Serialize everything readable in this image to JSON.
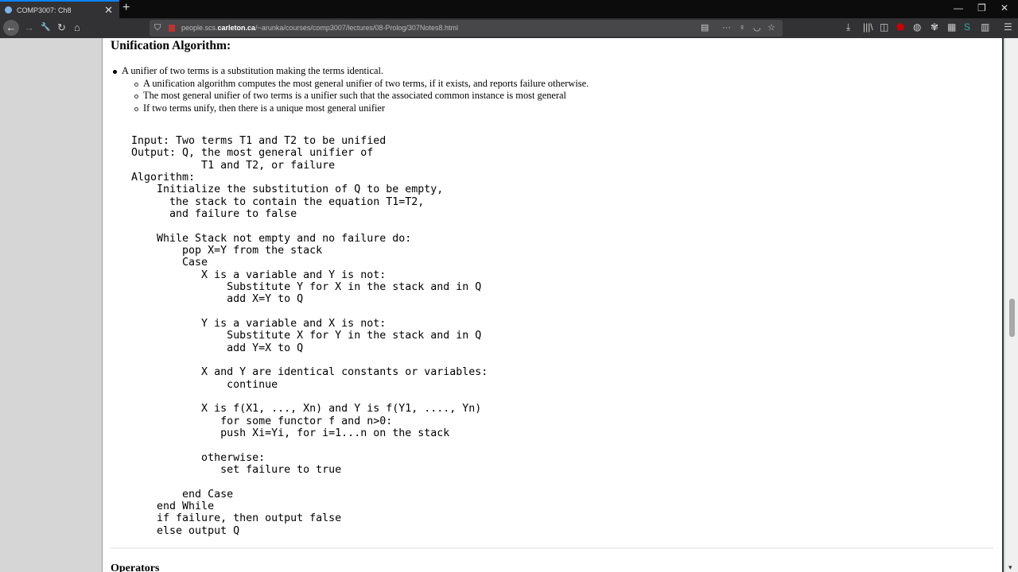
{
  "tab": {
    "title": "COMP3007: Ch8",
    "close": "✕",
    "new_tab": "+"
  },
  "window": {
    "minimize": "—",
    "restore": "❐",
    "close": "✕"
  },
  "nav": {
    "back": "←",
    "forward": "→",
    "tools": "🔧",
    "reload": "↻",
    "home": "⌂"
  },
  "url": {
    "prefix": "people.scs.",
    "domain": "carleton.ca",
    "path": "/~arunka/courses/comp3007/lectures/08-Prolog/307Notes8.html"
  },
  "toolbar_icons": [
    "reader-icon",
    "more-icon",
    "lightbulb-icon",
    "pocket-icon",
    "bookmark-star-icon",
    "download-icon",
    "library-icon",
    "sidebar-icon",
    "ublock-icon",
    "extension-icon",
    "extension2-icon",
    "notes-icon",
    "s-extension-icon",
    "grid-extension-icon",
    "menu-icon"
  ],
  "content": {
    "heading": "Unification Algorithm:",
    "bullet": "A unifier of two terms is a substitution making the terms identical.",
    "sub_bullets": [
      "A unification algorithm computes the most general unifier of two terms, if it exists, and reports failure otherwise.",
      "The most general unifier of two terms is a unifier such that the associated common instance is most general",
      "If two terms unify, then there is a unique most general unifier"
    ],
    "code": [
      "Input: Two terms T1 and T2 to be unified",
      "Output: Q, the most general unifier of",
      "           T1 and T2, or failure",
      "Algorithm:",
      "    Initialize the substitution of Q to be empty,",
      "      the stack to contain the equation T1=T2,",
      "      and failure to false",
      "",
      "    While Stack not empty and no failure do:",
      "        pop X=Y from the stack",
      "        Case",
      "           X is a variable and Y is not:",
      "               Substitute Y for X in the stack and in Q",
      "               add X=Y to Q",
      "",
      "           Y is a variable and X is not:",
      "               Substitute X for Y in the stack and in Q",
      "               add Y=X to Q",
      "",
      "           X and Y are identical constants or variables:",
      "               continue",
      "",
      "           X is f(X1, ..., Xn) and Y is f(Y1, ...., Yn)",
      "              for some functor f and n>0:",
      "              push Xi=Yi, for i=1...n on the stack",
      "",
      "           otherwise:",
      "              set failure to true",
      "",
      "        end Case",
      "    end While",
      "    if failure, then output false",
      "    else output Q"
    ],
    "next_heading": "Operators"
  }
}
